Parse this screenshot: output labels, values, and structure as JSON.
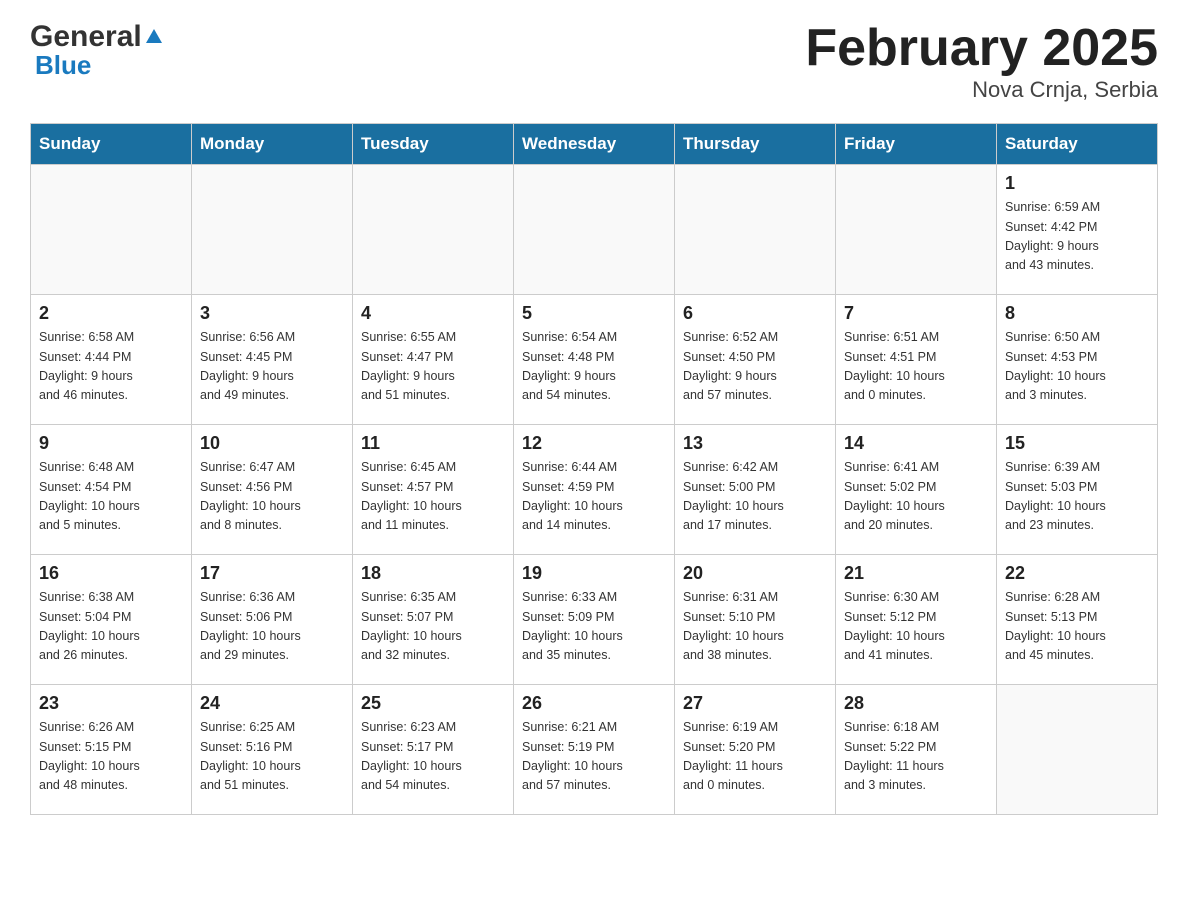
{
  "logo": {
    "general": "General",
    "blue": "Blue"
  },
  "title": "February 2025",
  "subtitle": "Nova Crnja, Serbia",
  "days_of_week": [
    "Sunday",
    "Monday",
    "Tuesday",
    "Wednesday",
    "Thursday",
    "Friday",
    "Saturday"
  ],
  "weeks": [
    [
      {
        "day": "",
        "info": ""
      },
      {
        "day": "",
        "info": ""
      },
      {
        "day": "",
        "info": ""
      },
      {
        "day": "",
        "info": ""
      },
      {
        "day": "",
        "info": ""
      },
      {
        "day": "",
        "info": ""
      },
      {
        "day": "1",
        "info": "Sunrise: 6:59 AM\nSunset: 4:42 PM\nDaylight: 9 hours\nand 43 minutes."
      }
    ],
    [
      {
        "day": "2",
        "info": "Sunrise: 6:58 AM\nSunset: 4:44 PM\nDaylight: 9 hours\nand 46 minutes."
      },
      {
        "day": "3",
        "info": "Sunrise: 6:56 AM\nSunset: 4:45 PM\nDaylight: 9 hours\nand 49 minutes."
      },
      {
        "day": "4",
        "info": "Sunrise: 6:55 AM\nSunset: 4:47 PM\nDaylight: 9 hours\nand 51 minutes."
      },
      {
        "day": "5",
        "info": "Sunrise: 6:54 AM\nSunset: 4:48 PM\nDaylight: 9 hours\nand 54 minutes."
      },
      {
        "day": "6",
        "info": "Sunrise: 6:52 AM\nSunset: 4:50 PM\nDaylight: 9 hours\nand 57 minutes."
      },
      {
        "day": "7",
        "info": "Sunrise: 6:51 AM\nSunset: 4:51 PM\nDaylight: 10 hours\nand 0 minutes."
      },
      {
        "day": "8",
        "info": "Sunrise: 6:50 AM\nSunset: 4:53 PM\nDaylight: 10 hours\nand 3 minutes."
      }
    ],
    [
      {
        "day": "9",
        "info": "Sunrise: 6:48 AM\nSunset: 4:54 PM\nDaylight: 10 hours\nand 5 minutes."
      },
      {
        "day": "10",
        "info": "Sunrise: 6:47 AM\nSunset: 4:56 PM\nDaylight: 10 hours\nand 8 minutes."
      },
      {
        "day": "11",
        "info": "Sunrise: 6:45 AM\nSunset: 4:57 PM\nDaylight: 10 hours\nand 11 minutes."
      },
      {
        "day": "12",
        "info": "Sunrise: 6:44 AM\nSunset: 4:59 PM\nDaylight: 10 hours\nand 14 minutes."
      },
      {
        "day": "13",
        "info": "Sunrise: 6:42 AM\nSunset: 5:00 PM\nDaylight: 10 hours\nand 17 minutes."
      },
      {
        "day": "14",
        "info": "Sunrise: 6:41 AM\nSunset: 5:02 PM\nDaylight: 10 hours\nand 20 minutes."
      },
      {
        "day": "15",
        "info": "Sunrise: 6:39 AM\nSunset: 5:03 PM\nDaylight: 10 hours\nand 23 minutes."
      }
    ],
    [
      {
        "day": "16",
        "info": "Sunrise: 6:38 AM\nSunset: 5:04 PM\nDaylight: 10 hours\nand 26 minutes."
      },
      {
        "day": "17",
        "info": "Sunrise: 6:36 AM\nSunset: 5:06 PM\nDaylight: 10 hours\nand 29 minutes."
      },
      {
        "day": "18",
        "info": "Sunrise: 6:35 AM\nSunset: 5:07 PM\nDaylight: 10 hours\nand 32 minutes."
      },
      {
        "day": "19",
        "info": "Sunrise: 6:33 AM\nSunset: 5:09 PM\nDaylight: 10 hours\nand 35 minutes."
      },
      {
        "day": "20",
        "info": "Sunrise: 6:31 AM\nSunset: 5:10 PM\nDaylight: 10 hours\nand 38 minutes."
      },
      {
        "day": "21",
        "info": "Sunrise: 6:30 AM\nSunset: 5:12 PM\nDaylight: 10 hours\nand 41 minutes."
      },
      {
        "day": "22",
        "info": "Sunrise: 6:28 AM\nSunset: 5:13 PM\nDaylight: 10 hours\nand 45 minutes."
      }
    ],
    [
      {
        "day": "23",
        "info": "Sunrise: 6:26 AM\nSunset: 5:15 PM\nDaylight: 10 hours\nand 48 minutes."
      },
      {
        "day": "24",
        "info": "Sunrise: 6:25 AM\nSunset: 5:16 PM\nDaylight: 10 hours\nand 51 minutes."
      },
      {
        "day": "25",
        "info": "Sunrise: 6:23 AM\nSunset: 5:17 PM\nDaylight: 10 hours\nand 54 minutes."
      },
      {
        "day": "26",
        "info": "Sunrise: 6:21 AM\nSunset: 5:19 PM\nDaylight: 10 hours\nand 57 minutes."
      },
      {
        "day": "27",
        "info": "Sunrise: 6:19 AM\nSunset: 5:20 PM\nDaylight: 11 hours\nand 0 minutes."
      },
      {
        "day": "28",
        "info": "Sunrise: 6:18 AM\nSunset: 5:22 PM\nDaylight: 11 hours\nand 3 minutes."
      },
      {
        "day": "",
        "info": ""
      }
    ]
  ]
}
